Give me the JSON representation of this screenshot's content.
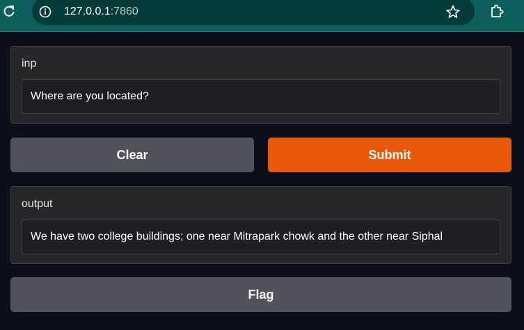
{
  "browser": {
    "url_host": "127.0.0.1",
    "url_port": ":7860",
    "icons": [
      "reload-icon",
      "info-icon",
      "star-icon",
      "extensions-icon"
    ]
  },
  "inputs": {
    "label": "inp",
    "value": "Where are you located?"
  },
  "buttons": {
    "clear": "Clear",
    "submit": "Submit",
    "flag": "Flag"
  },
  "output": {
    "label": "output",
    "value": "We have two college buildings; one near Mitrapark chowk and the other near Siphal"
  },
  "colors": {
    "submit_accent": "#ea580c",
    "secondary_button": "#52525b",
    "panel": "#27272a",
    "background": "#0b0f19",
    "browser_bar": "#0c5f5b"
  }
}
